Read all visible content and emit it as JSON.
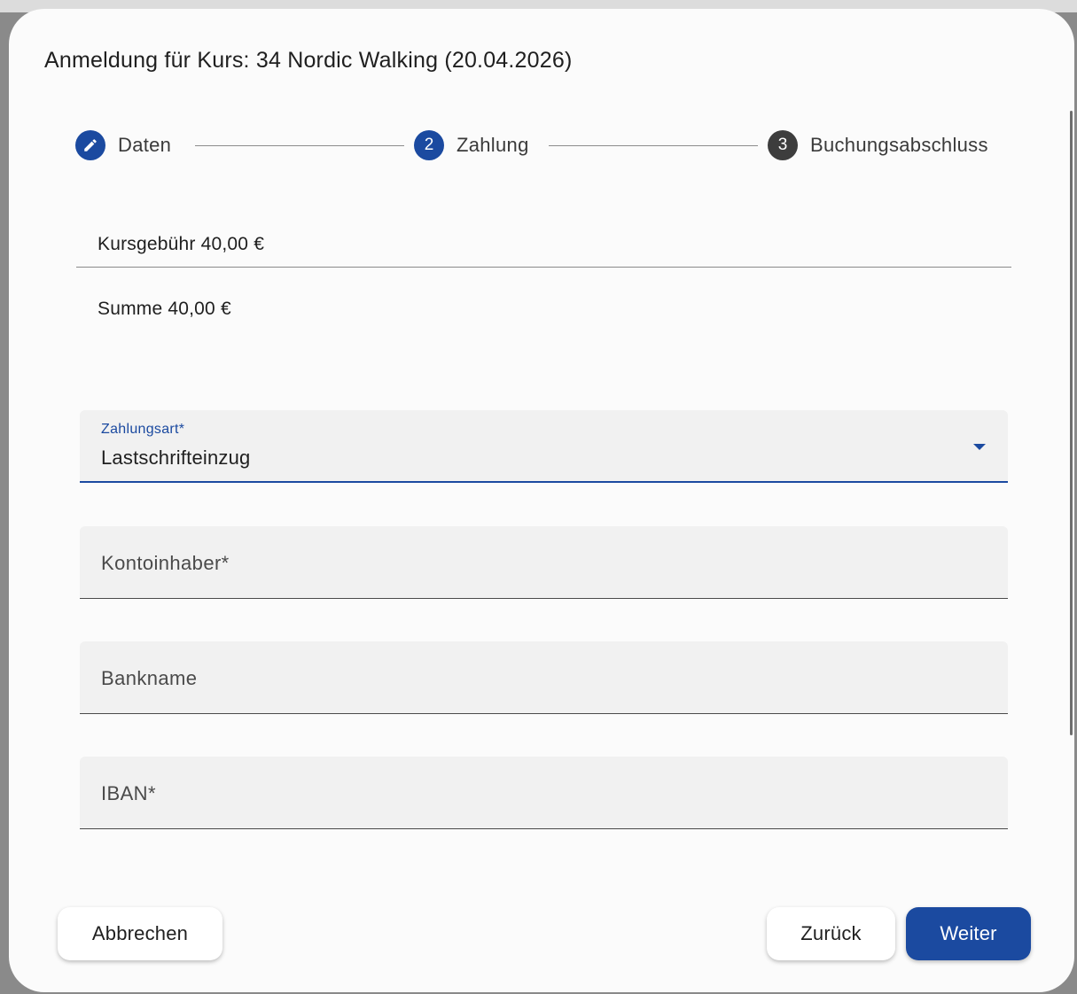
{
  "dialog": {
    "title": "Anmeldung für Kurs: 34 Nordic Walking (20.04.2026)"
  },
  "stepper": {
    "steps": [
      {
        "number": "",
        "label": "Daten",
        "icon": "pencil-icon"
      },
      {
        "number": "2",
        "label": "Zahlung"
      },
      {
        "number": "3",
        "label": "Buchungsabschluss"
      }
    ],
    "active_color": "#1b4aa0",
    "inactive_color": "#3d3d3d"
  },
  "summary": {
    "fee": "Kursgebühr 40,00 €",
    "total": "Summe 40,00 €"
  },
  "form": {
    "payment_method": {
      "label": "Zahlungsart*",
      "value": "Lastschrifteinzug"
    },
    "account_holder": {
      "placeholder": "Kontoinhaber*"
    },
    "bank_name": {
      "placeholder": "Bankname"
    },
    "iban": {
      "placeholder": "IBAN*"
    }
  },
  "actions": {
    "cancel": "Abbrechen",
    "back": "Zurück",
    "next": "Weiter"
  },
  "colors": {
    "primary": "#1b4aa0"
  }
}
